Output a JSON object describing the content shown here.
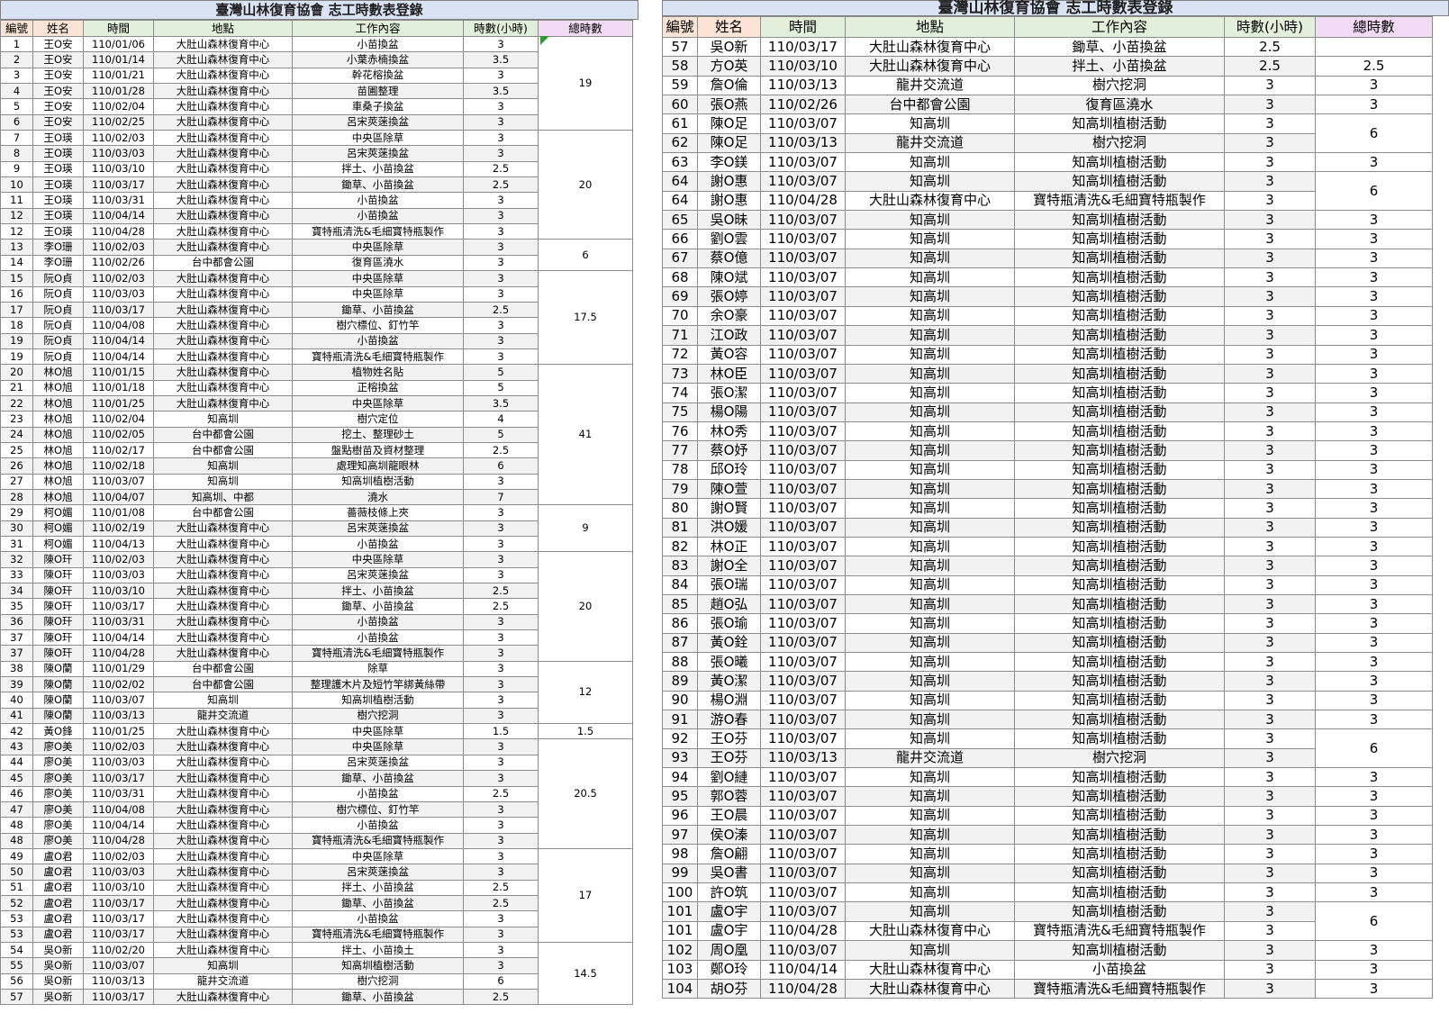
{
  "left": {
    "title": "臺灣山林復育協會 志工時數表登錄",
    "headers": [
      "編號",
      "姓名",
      "時間",
      "地點",
      "工作內容",
      "時數(小時)",
      "總時數"
    ],
    "rows": [
      [
        "1",
        "王O安",
        "110/01/06",
        "大肚山森林復育中心",
        "小苗換盆",
        "3"
      ],
      [
        "2",
        "王O安",
        "110/01/14",
        "大肚山森林復育中心",
        "小葉赤楠換盆",
        "3.5"
      ],
      [
        "3",
        "王O安",
        "110/01/21",
        "大肚山森林復育中心",
        "幹花榕換盆",
        "3"
      ],
      [
        "4",
        "王O安",
        "110/01/28",
        "大肚山森林復育中心",
        "苗圃整理",
        "3.5"
      ],
      [
        "5",
        "王O安",
        "110/02/04",
        "大肚山森林復育中心",
        "車桑子換盆",
        "3"
      ],
      [
        "6",
        "王O安",
        "110/02/25",
        "大肚山森林復育中心",
        "呂宋莢蒾換盆",
        "3"
      ],
      [
        "7",
        "王O瑛",
        "110/02/03",
        "大肚山森林復育中心",
        "中央區除草",
        "3"
      ],
      [
        "8",
        "王O瑛",
        "110/03/03",
        "大肚山森林復育中心",
        "呂宋莢蒾換盆",
        "3"
      ],
      [
        "9",
        "王O瑛",
        "110/03/10",
        "大肚山森林復育中心",
        "拌土、小苗換盆",
        "2.5"
      ],
      [
        "10",
        "王O瑛",
        "110/03/17",
        "大肚山森林復育中心",
        "鋤草、小苗換盆",
        "2.5"
      ],
      [
        "11",
        "王O瑛",
        "110/03/31",
        "大肚山森林復育中心",
        "小苗換盆",
        "3"
      ],
      [
        "12",
        "王O瑛",
        "110/04/14",
        "大肚山森林復育中心",
        "小苗換盆",
        "3"
      ],
      [
        "12",
        "王O瑛",
        "110/04/28",
        "大肚山森林復育中心",
        "寶特瓶清洗&毛細寶特瓶製作",
        "3"
      ],
      [
        "13",
        "李O珊",
        "110/02/03",
        "大肚山森林復育中心",
        "中央區除草",
        "3"
      ],
      [
        "14",
        "李O珊",
        "110/02/26",
        "台中都會公園",
        "復育區澆水",
        "3"
      ],
      [
        "15",
        "阮O貞",
        "110/02/03",
        "大肚山森林復育中心",
        "中央區除草",
        "3"
      ],
      [
        "16",
        "阮O貞",
        "110/03/03",
        "大肚山森林復育中心",
        "中央區除草",
        "3"
      ],
      [
        "17",
        "阮O貞",
        "110/03/17",
        "大肚山森林復育中心",
        "鋤草、小苗換盆",
        "2.5"
      ],
      [
        "18",
        "阮O貞",
        "110/04/08",
        "大肚山森林復育中心",
        "樹穴標位、釘竹竿",
        "3"
      ],
      [
        "19",
        "阮O貞",
        "110/04/14",
        "大肚山森林復育中心",
        "小苗換盆",
        "3"
      ],
      [
        "19",
        "阮O貞",
        "110/04/14",
        "大肚山森林復育中心",
        "寶特瓶清洗&毛細寶特瓶製作",
        "3"
      ],
      [
        "20",
        "林O旭",
        "110/01/15",
        "大肚山森林復育中心",
        "植物姓名貼",
        "5"
      ],
      [
        "21",
        "林O旭",
        "110/01/18",
        "大肚山森林復育中心",
        "正榕換盆",
        "5"
      ],
      [
        "22",
        "林O旭",
        "110/01/25",
        "大肚山森林復育中心",
        "中央區除草",
        "3.5"
      ],
      [
        "23",
        "林O旭",
        "110/02/04",
        "知高圳",
        "樹穴定位",
        "4"
      ],
      [
        "24",
        "林O旭",
        "110/02/05",
        "台中都會公園",
        "挖土、整理砂土",
        "5"
      ],
      [
        "25",
        "林O旭",
        "110/02/17",
        "台中都會公園",
        "盤點樹苗及資材整理",
        "2.5"
      ],
      [
        "26",
        "林O旭",
        "110/02/18",
        "知高圳",
        "處理知高圳龍眼林",
        "6"
      ],
      [
        "27",
        "林O旭",
        "110/03/07",
        "知高圳",
        "知高圳植樹活動",
        "3"
      ],
      [
        "28",
        "林O旭",
        "110/04/07",
        "知高圳、中都",
        "澆水",
        "7"
      ],
      [
        "29",
        "柯O媚",
        "110/01/08",
        "台中都會公園",
        "薔薇枝條上夾",
        "3"
      ],
      [
        "30",
        "柯O媚",
        "110/02/19",
        "大肚山森林復育中心",
        "呂宋莢蒾換盆",
        "3"
      ],
      [
        "31",
        "柯O媚",
        "110/04/13",
        "大肚山森林復育中心",
        "小苗換盆",
        "3"
      ],
      [
        "32",
        "陳O玕",
        "110/02/03",
        "大肚山森林復育中心",
        "中央區除草",
        "3"
      ],
      [
        "33",
        "陳O玕",
        "110/03/03",
        "大肚山森林復育中心",
        "呂宋莢蒾換盆",
        "3"
      ],
      [
        "34",
        "陳O玕",
        "110/03/10",
        "大肚山森林復育中心",
        "拌土、小苗換盆",
        "2.5"
      ],
      [
        "35",
        "陳O玕",
        "110/03/17",
        "大肚山森林復育中心",
        "鋤草、小苗換盆",
        "2.5"
      ],
      [
        "36",
        "陳O玕",
        "110/03/31",
        "大肚山森林復育中心",
        "小苗換盆",
        "3"
      ],
      [
        "37",
        "陳O玕",
        "110/04/14",
        "大肚山森林復育中心",
        "小苗換盆",
        "3"
      ],
      [
        "37",
        "陳O玕",
        "110/04/28",
        "大肚山森林復育中心",
        "寶特瓶清洗&毛細寶特瓶製作",
        "3"
      ],
      [
        "38",
        "陳O蘭",
        "110/01/29",
        "台中都會公園",
        "除草",
        "3"
      ],
      [
        "39",
        "陳O蘭",
        "110/02/02",
        "台中都會公園",
        "整理護木片及短竹竿綁黃絲帶",
        "3"
      ],
      [
        "40",
        "陳O蘭",
        "110/03/07",
        "知高圳",
        "知高圳植樹活動",
        "3"
      ],
      [
        "41",
        "陳O蘭",
        "110/03/13",
        "龍井交流道",
        "樹穴挖洞",
        "3"
      ],
      [
        "42",
        "黃O鋒",
        "110/01/25",
        "大肚山森林復育中心",
        "中央區除草",
        "1.5"
      ],
      [
        "43",
        "廖O美",
        "110/02/03",
        "大肚山森林復育中心",
        "中央區除草",
        "3"
      ],
      [
        "44",
        "廖O美",
        "110/03/03",
        "大肚山森林復育中心",
        "呂宋莢蒾換盆",
        "3"
      ],
      [
        "45",
        "廖O美",
        "110/03/17",
        "大肚山森林復育中心",
        "鋤草、小苗換盆",
        "3"
      ],
      [
        "46",
        "廖O美",
        "110/03/31",
        "大肚山森林復育中心",
        "小苗換盆",
        "2.5"
      ],
      [
        "47",
        "廖O美",
        "110/04/08",
        "大肚山森林復育中心",
        "樹穴標位、釘竹竿",
        "3"
      ],
      [
        "48",
        "廖O美",
        "110/04/14",
        "大肚山森林復育中心",
        "小苗換盆",
        "3"
      ],
      [
        "48",
        "廖O美",
        "110/04/28",
        "大肚山森林復育中心",
        "寶特瓶清洗&毛細寶特瓶製作",
        "3"
      ],
      [
        "49",
        "盧O君",
        "110/02/03",
        "大肚山森林復育中心",
        "中央區除草",
        "3"
      ],
      [
        "50",
        "盧O君",
        "110/03/03",
        "大肚山森林復育中心",
        "呂宋莢蒾換盆",
        "3"
      ],
      [
        "51",
        "盧O君",
        "110/03/10",
        "大肚山森林復育中心",
        "拌土、小苗換盆",
        "2.5"
      ],
      [
        "52",
        "盧O君",
        "110/03/17",
        "大肚山森林復育中心",
        "鋤草、小苗換盆",
        "2.5"
      ],
      [
        "53",
        "盧O君",
        "110/03/17",
        "大肚山森林復育中心",
        "小苗換盆",
        "3"
      ],
      [
        "53",
        "盧O君",
        "110/03/17",
        "大肚山森林復育中心",
        "寶特瓶清洗&毛細寶特瓶製作",
        "3"
      ],
      [
        "54",
        "吳O新",
        "110/02/20",
        "大肚山森林復育中心",
        "拌土、小苗換土",
        "3"
      ],
      [
        "55",
        "吳O新",
        "110/03/07",
        "知高圳",
        "知高圳植樹活動",
        "3"
      ],
      [
        "56",
        "吳O新",
        "110/03/13",
        "龍井交流道",
        "樹穴挖洞",
        "6"
      ],
      [
        "57",
        "吳O新",
        "110/03/17",
        "大肚山森林復育中心",
        "鋤草、小苗換盆",
        "2.5"
      ]
    ],
    "totals": [
      {
        "value": "19",
        "span": 6
      },
      {
        "value": "20",
        "span": 7
      },
      {
        "value": "6",
        "span": 2
      },
      {
        "value": "17.5",
        "span": 6
      },
      {
        "value": "41",
        "span": 9
      },
      {
        "value": "9",
        "span": 3
      },
      {
        "value": "20",
        "span": 7
      },
      {
        "value": "12",
        "span": 4
      },
      {
        "value": "1.5",
        "span": 1
      },
      {
        "value": "20.5",
        "span": 7
      },
      {
        "value": "17",
        "span": 6
      },
      {
        "value": "14.5",
        "span": 4
      }
    ]
  },
  "right": {
    "title": "臺灣山林復育協會 志工時數表登錄",
    "headers": [
      "編號",
      "姓名",
      "時間",
      "地點",
      "工作內容",
      "時數(小時)",
      "總時數"
    ],
    "rows": [
      [
        "57",
        "吳O新",
        "110/03/17",
        "大肚山森林復育中心",
        "鋤草、小苗換盆",
        "2.5"
      ],
      [
        "58",
        "方O英",
        "110/03/10",
        "大肚山森林復育中心",
        "拌土、小苗換盆",
        "2.5"
      ],
      [
        "59",
        "詹O倫",
        "110/03/13",
        "龍井交流道",
        "樹穴挖洞",
        "3"
      ],
      [
        "60",
        "張O燕",
        "110/02/26",
        "台中都會公園",
        "復育區澆水",
        "3"
      ],
      [
        "61",
        "陳O足",
        "110/03/07",
        "知高圳",
        "知高圳植樹活動",
        "3"
      ],
      [
        "62",
        "陳O足",
        "110/03/13",
        "龍井交流道",
        "樹穴挖洞",
        "3"
      ],
      [
        "63",
        "李O鎂",
        "110/03/07",
        "知高圳",
        "知高圳植樹活動",
        "3"
      ],
      [
        "64",
        "謝O惠",
        "110/03/07",
        "知高圳",
        "知高圳植樹活動",
        "3"
      ],
      [
        "64",
        "謝O惠",
        "110/04/28",
        "大肚山森林復育中心",
        "寶特瓶清洗&毛細寶特瓶製作",
        "3"
      ],
      [
        "65",
        "吳O昧",
        "110/03/07",
        "知高圳",
        "知高圳植樹活動",
        "3"
      ],
      [
        "66",
        "劉O雲",
        "110/03/07",
        "知高圳",
        "知高圳植樹活動",
        "3"
      ],
      [
        "67",
        "蔡O億",
        "110/03/07",
        "知高圳",
        "知高圳植樹活動",
        "3"
      ],
      [
        "68",
        "陳O斌",
        "110/03/07",
        "知高圳",
        "知高圳植樹活動",
        "3"
      ],
      [
        "69",
        "張O婷",
        "110/03/07",
        "知高圳",
        "知高圳植樹活動",
        "3"
      ],
      [
        "70",
        "余O豪",
        "110/03/07",
        "知高圳",
        "知高圳植樹活動",
        "3"
      ],
      [
        "71",
        "江O政",
        "110/03/07",
        "知高圳",
        "知高圳植樹活動",
        "3"
      ],
      [
        "72",
        "黃O容",
        "110/03/07",
        "知高圳",
        "知高圳植樹活動",
        "3"
      ],
      [
        "73",
        "林O臣",
        "110/03/07",
        "知高圳",
        "知高圳植樹活動",
        "3"
      ],
      [
        "74",
        "張O潔",
        "110/03/07",
        "知高圳",
        "知高圳植樹活動",
        "3"
      ],
      [
        "75",
        "楊O陽",
        "110/03/07",
        "知高圳",
        "知高圳植樹活動",
        "3"
      ],
      [
        "76",
        "林O秀",
        "110/03/07",
        "知高圳",
        "知高圳植樹活動",
        "3"
      ],
      [
        "77",
        "蔡O妤",
        "110/03/07",
        "知高圳",
        "知高圳植樹活動",
        "3"
      ],
      [
        "78",
        "邱O玲",
        "110/03/07",
        "知高圳",
        "知高圳植樹活動",
        "3"
      ],
      [
        "79",
        "陳O萱",
        "110/03/07",
        "知高圳",
        "知高圳植樹活動",
        "3"
      ],
      [
        "80",
        "謝O賢",
        "110/03/07",
        "知高圳",
        "知高圳植樹活動",
        "3"
      ],
      [
        "81",
        "洪O媛",
        "110/03/07",
        "知高圳",
        "知高圳植樹活動",
        "3"
      ],
      [
        "82",
        "林O正",
        "110/03/07",
        "知高圳",
        "知高圳植樹活動",
        "3"
      ],
      [
        "83",
        "謝O全",
        "110/03/07",
        "知高圳",
        "知高圳植樹活動",
        "3"
      ],
      [
        "84",
        "張O瑞",
        "110/03/07",
        "知高圳",
        "知高圳植樹活動",
        "3"
      ],
      [
        "85",
        "趙O弘",
        "110/03/07",
        "知高圳",
        "知高圳植樹活動",
        "3"
      ],
      [
        "86",
        "張O瑜",
        "110/03/07",
        "知高圳",
        "知高圳植樹活動",
        "3"
      ],
      [
        "87",
        "黃O銓",
        "110/03/07",
        "知高圳",
        "知高圳植樹活動",
        "3"
      ],
      [
        "88",
        "張O曦",
        "110/03/07",
        "知高圳",
        "知高圳植樹活動",
        "3"
      ],
      [
        "89",
        "黃O潔",
        "110/03/07",
        "知高圳",
        "知高圳植樹活動",
        "3"
      ],
      [
        "90",
        "楊O淵",
        "110/03/07",
        "知高圳",
        "知高圳植樹活動",
        "3"
      ],
      [
        "91",
        "游O春",
        "110/03/07",
        "知高圳",
        "知高圳植樹活動",
        "3"
      ],
      [
        "92",
        "王O芬",
        "110/03/07",
        "知高圳",
        "知高圳植樹活動",
        "3"
      ],
      [
        "93",
        "王O芬",
        "110/03/13",
        "龍井交流道",
        "樹穴挖洞",
        "3"
      ],
      [
        "94",
        "劉O縺",
        "110/03/07",
        "知高圳",
        "知高圳植樹活動",
        "3"
      ],
      [
        "95",
        "郭O蓉",
        "110/03/07",
        "知高圳",
        "知高圳植樹活動",
        "3"
      ],
      [
        "96",
        "王O晨",
        "110/03/07",
        "知高圳",
        "知高圳植樹活動",
        "3"
      ],
      [
        "97",
        "侯O溱",
        "110/03/07",
        "知高圳",
        "知高圳植樹活動",
        "3"
      ],
      [
        "98",
        "詹O翩",
        "110/03/07",
        "知高圳",
        "知高圳植樹活動",
        "3"
      ],
      [
        "99",
        "吳O書",
        "110/03/07",
        "知高圳",
        "知高圳植樹活動",
        "3"
      ],
      [
        "100",
        "許O筑",
        "110/03/07",
        "知高圳",
        "知高圳植樹活動",
        "3"
      ],
      [
        "101",
        "盧O宇",
        "110/03/07",
        "知高圳",
        "知高圳植樹活動",
        "3"
      ],
      [
        "101",
        "盧O宇",
        "110/04/28",
        "大肚山森林復育中心",
        "寶特瓶清洗&毛細寶特瓶製作",
        "3"
      ],
      [
        "102",
        "周O凰",
        "110/03/07",
        "知高圳",
        "知高圳植樹活動",
        "3"
      ],
      [
        "103",
        "鄭O玲",
        "110/04/14",
        "大肚山森林復育中心",
        "小苗換盆",
        "3"
      ],
      [
        "104",
        "胡O芬",
        "110/04/28",
        "大肚山森林復育中心",
        "寶特瓶清洗&毛細寶特瓶製作",
        "3"
      ]
    ],
    "totals": [
      {
        "value": "",
        "span": 1
      },
      {
        "value": "2.5",
        "span": 1
      },
      {
        "value": "3",
        "span": 1
      },
      {
        "value": "3",
        "span": 1
      },
      {
        "value": "6",
        "span": 2
      },
      {
        "value": "3",
        "span": 1
      },
      {
        "value": "6",
        "span": 2
      },
      {
        "value": "3",
        "span": 1
      },
      {
        "value": "3",
        "span": 1
      },
      {
        "value": "3",
        "span": 1
      },
      {
        "value": "3",
        "span": 1
      },
      {
        "value": "3",
        "span": 1
      },
      {
        "value": "3",
        "span": 1
      },
      {
        "value": "3",
        "span": 1
      },
      {
        "value": "3",
        "span": 1
      },
      {
        "value": "3",
        "span": 1
      },
      {
        "value": "3",
        "span": 1
      },
      {
        "value": "3",
        "span": 1
      },
      {
        "value": "3",
        "span": 1
      },
      {
        "value": "3",
        "span": 1
      },
      {
        "value": "3",
        "span": 1
      },
      {
        "value": "3",
        "span": 1
      },
      {
        "value": "3",
        "span": 1
      },
      {
        "value": "3",
        "span": 1
      },
      {
        "value": "3",
        "span": 1
      },
      {
        "value": "3",
        "span": 1
      },
      {
        "value": "3",
        "span": 1
      },
      {
        "value": "3",
        "span": 1
      },
      {
        "value": "3",
        "span": 1
      },
      {
        "value": "3",
        "span": 1
      },
      {
        "value": "3",
        "span": 1
      },
      {
        "value": "3",
        "span": 1
      },
      {
        "value": "3",
        "span": 1
      },
      {
        "value": "3",
        "span": 1
      },
      {
        "value": "6",
        "span": 2
      },
      {
        "value": "3",
        "span": 1
      },
      {
        "value": "3",
        "span": 1
      },
      {
        "value": "3",
        "span": 1
      },
      {
        "value": "3",
        "span": 1
      },
      {
        "value": "3",
        "span": 1
      },
      {
        "value": "3",
        "span": 1
      },
      {
        "value": "3",
        "span": 1
      },
      {
        "value": "6",
        "span": 2
      },
      {
        "value": "3",
        "span": 1
      },
      {
        "value": "3",
        "span": 1
      },
      {
        "value": "3",
        "span": 1
      }
    ]
  }
}
